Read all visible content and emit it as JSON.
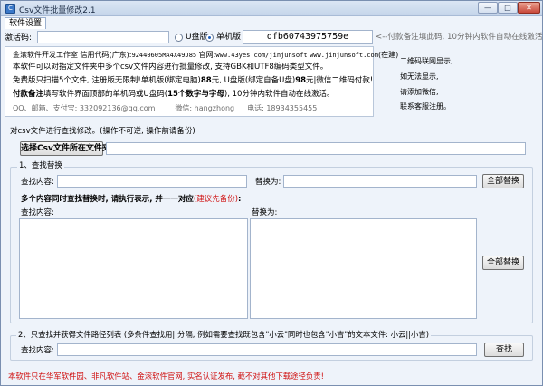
{
  "window": {
    "title": "Csv文件批量修改2.1",
    "minimize": "—",
    "maximize": "□",
    "close": "✕"
  },
  "menu": {
    "settings": "软件设置"
  },
  "activation": {
    "code_label": "激活码:",
    "code_value": "",
    "usb_label": "U盘版",
    "standalone_label": "单机版",
    "selected": "standalone",
    "machine_code": "dfb60743975759e",
    "hint": "<--付款备注填此码, 10分钟内软件自动在线激活!"
  },
  "info": {
    "line1_a": "金滚软件开发工作室 信用代码(广东):",
    "line1_b": "92440605MA4X49J85",
    "line1_c": " 官网:",
    "line1_d": "www.43yes.com/jinjunsoft",
    "line1_e": "www.jinjunsoft.com",
    "line1_f": "(在建)",
    "line2": "本软件可以对指定文件夹中多个csv文件内容进行批量修改, 支持GBK和UTF8编码类型文件。",
    "line3_a": "免费版只扫描5个文件, 注册版无限制!单机版(绑定电脑)",
    "line3_b": "88",
    "line3_c": "元, U盘版(绑定自备U盘)",
    "line3_d": "98",
    "line3_e": "元|微信二维码付款!",
    "line4_a": "付款备注",
    "line4_b": "填写软件界面顶部的单机码或U盘码(",
    "line4_c": "15个数字与字母",
    "line4_d": "), 10分钟内软件自动在线激活。",
    "line5_a": "QQ、邮箱、支付宝: 332092136@qq.com",
    "line5_b": "微信: hangzhong",
    "line5_c": "电话: 18934355455"
  },
  "qr": {
    "line1": "二维码联网显示,",
    "line2": "如无法显示,",
    "line3": "请添加微信,",
    "line4": "联系客服注册。"
  },
  "folder": {
    "section_label": "对csv文件进行查找修改。(操作不可逆, 操作前请备份)",
    "select_button": "选择Csv文件所在文件夹",
    "path_value": ""
  },
  "replace": {
    "group_title": "1、查找替换",
    "find_label": "查找内容:",
    "find_value": "",
    "replace_label": "替换为:",
    "replace_value": "",
    "replace_all_button": "全部替换",
    "multi_note_a": "多个内容同时查找替换时, 请执行表示, 并一一对应",
    "multi_note_b": "(建议先备份)",
    "multi_note_c": ":",
    "multi_find_label": "查找内容:",
    "multi_find_value": "",
    "multi_replace_label": "替换为:",
    "multi_replace_value": "",
    "multi_replace_all_button": "全部替换"
  },
  "find_files": {
    "group_title": "2、只查找并获得文件路径列表 (多条件查找用||分隔, 例如需要查找既包含\"小云\"同时也包含\"小吉\"的文本文件: 小云||小吉)",
    "find_label": "查找内容:",
    "find_value": "",
    "find_button": "查找"
  },
  "footer": {
    "notice": "本软件只在华军软件园、非凡软件站、金滚软件官网, 实名认证发布, 截不对其他下载途径负责!"
  }
}
